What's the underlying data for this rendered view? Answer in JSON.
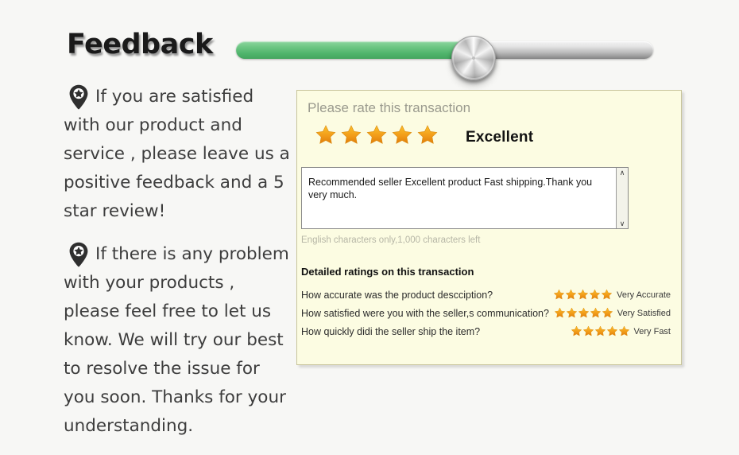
{
  "header": {
    "title": "Feedback",
    "slider": {
      "name": "progress-slider",
      "fill_percent": 57,
      "fill_color": "#4fb46b",
      "track_color": "#bdbdbd",
      "knob_color": "#cfcfcf"
    }
  },
  "left_column": {
    "notes": [
      {
        "icon": "map-pin-star-icon",
        "text": "If you are satisfied with our product and service , please leave us a positive feedback and a 5 star review!"
      },
      {
        "icon": "map-pin-star-icon",
        "text": "If there is any problem with your products , please feel free to let us know. We will try our best to resolve the issue for you soon. Thanks for your understanding."
      }
    ]
  },
  "rating_panel": {
    "heading": "Please rate this transaction",
    "star_rating": 5,
    "star_color": "#f0a017",
    "rating_word": "Excellent",
    "comment": {
      "value": "Recommended seller Excellent product Fast shipping.Thank you very much.",
      "placeholder": "",
      "scrollbar": {
        "up_arrow": "∧",
        "down_arrow": "∨"
      }
    },
    "char_hint": "English characters only,1,000 characters left",
    "detail_heading": "Detailed ratings on this transaction",
    "detail_rows": [
      {
        "question": "How accurate was the product descciption?",
        "stars": 5,
        "label": "Very Accurate"
      },
      {
        "question": "How satisfied were you with the seller,s communication?",
        "stars": 5,
        "label": "Very Satisfied"
      },
      {
        "question": "How quickly didi the seller ship the item?",
        "stars": 5,
        "label": "Very Fast"
      }
    ]
  }
}
